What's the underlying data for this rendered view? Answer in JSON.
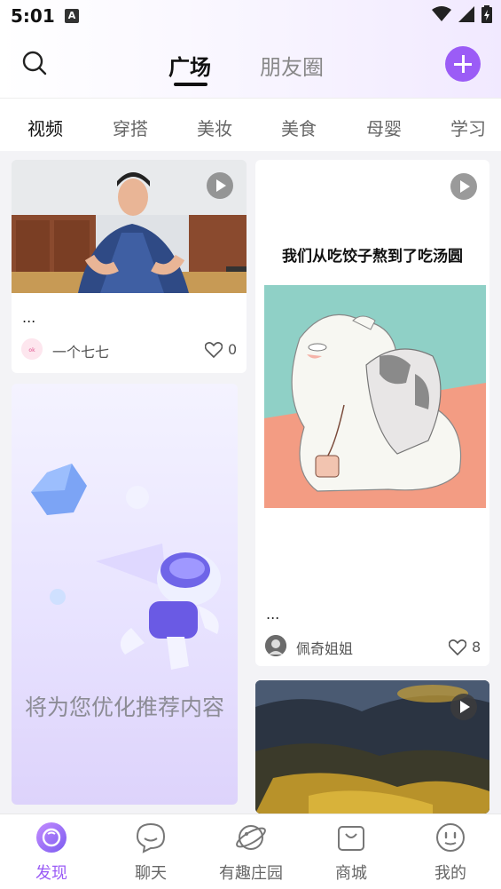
{
  "status_bar": {
    "time": "5:01",
    "badge": "A"
  },
  "header": {
    "tabs": [
      {
        "label": "广场",
        "active": true
      },
      {
        "label": "朋友圈",
        "active": false
      }
    ],
    "accent_color": "#9b5cf6"
  },
  "categories": [
    "视频",
    "穿搭",
    "美妆",
    "美食",
    "母婴",
    "学习"
  ],
  "feed": {
    "card1": {
      "text": "...",
      "author": "一个七七",
      "likes": "0"
    },
    "card2": {
      "overlay_text": "将为您优化推荐内容"
    },
    "card3": {
      "image_caption": "我们从吃饺子熬到了吃汤圆",
      "text": "...",
      "author": "佩奇姐姐",
      "likes": "8"
    },
    "card4": {}
  },
  "bottom_nav": [
    {
      "label": "发现",
      "icon": "discover-icon",
      "active": true
    },
    {
      "label": "聊天",
      "icon": "chat-icon",
      "active": false
    },
    {
      "label": "有趣庄园",
      "icon": "planet-icon",
      "active": false
    },
    {
      "label": "商城",
      "icon": "shopping-bag-icon",
      "active": false
    },
    {
      "label": "我的",
      "icon": "profile-face-icon",
      "active": false
    }
  ]
}
